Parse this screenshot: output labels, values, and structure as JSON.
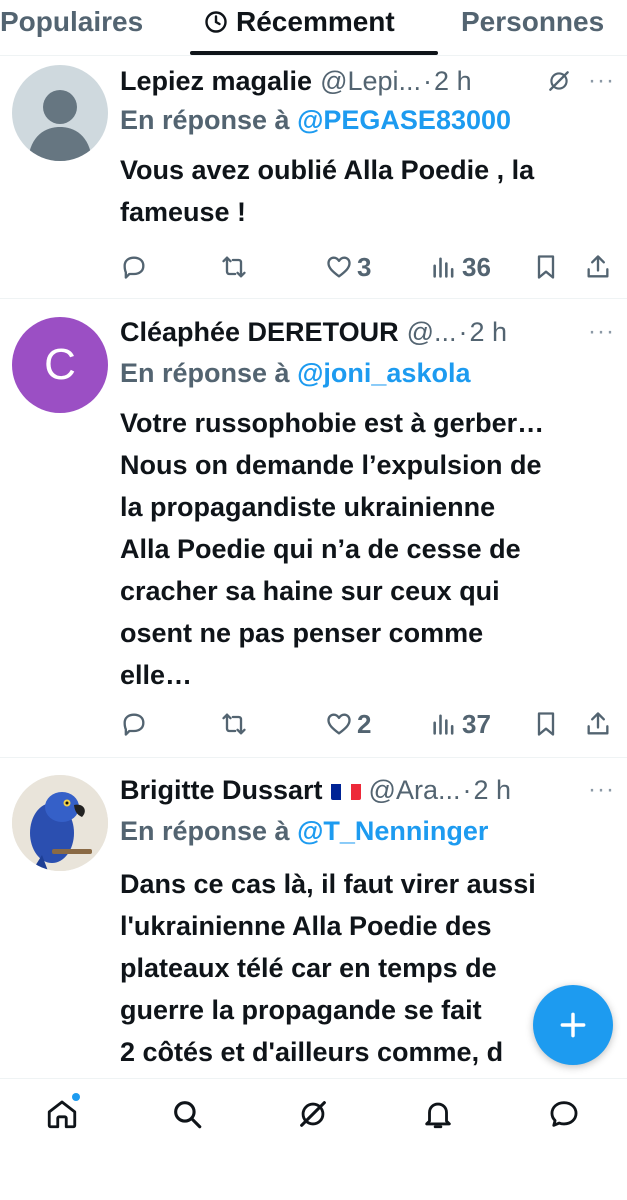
{
  "tabs": {
    "populaires": "Populaires",
    "recemment": "Récemment",
    "personnes": "Personnes"
  },
  "tweets": [
    {
      "name": "Lepiez magalie",
      "handle": "@Lepi...",
      "time": "2 h",
      "reply_prefix": "En réponse à",
      "reply_to": "@PEGASE83000",
      "text": "Vous avez oublié Alla Poedie , la\nfameuse !",
      "replies": "",
      "retweets": "",
      "likes": "3",
      "views": "36"
    },
    {
      "name": "Cléaphée DERETOUR",
      "handle": "@...",
      "time": "2 h",
      "avatar_letter": "C",
      "reply_prefix": "En réponse à",
      "reply_to": "@joni_askola",
      "text": "Votre russophobie est à gerber…\nNous on demande l’expulsion de\nla propagandiste ukrainienne\nAlla Poedie qui n’a de cesse de\ncracher sa haine sur ceux qui\nosent ne pas penser comme\nelle…",
      "replies": "",
      "retweets": "",
      "likes": "2",
      "views": "37"
    },
    {
      "name": "Brigitte Dussart",
      "handle": "@Ara...",
      "time": "2 h",
      "reply_prefix": "En réponse à",
      "reply_to": "@T_Nenninger",
      "text": "Dans ce cas là, il faut virer aussi\nl'ukrainienne Alla Poedie des\nplateaux télé car en temps de\nguerre la propagande se fait\n2 côtés et d'ailleurs comme, d",
      "flag_colors": [
        "#002395",
        "#ffffff",
        "#ed2939"
      ]
    }
  ],
  "separator": "·",
  "more_label": "···",
  "colors": {
    "accent": "#1d9bf0",
    "text": "#0f1419",
    "secondary": "#536471"
  },
  "icons": {
    "fab": "plus-icon",
    "nav": [
      "home-icon",
      "search-icon",
      "grok-icon",
      "notifications-icon",
      "messages-icon"
    ]
  }
}
